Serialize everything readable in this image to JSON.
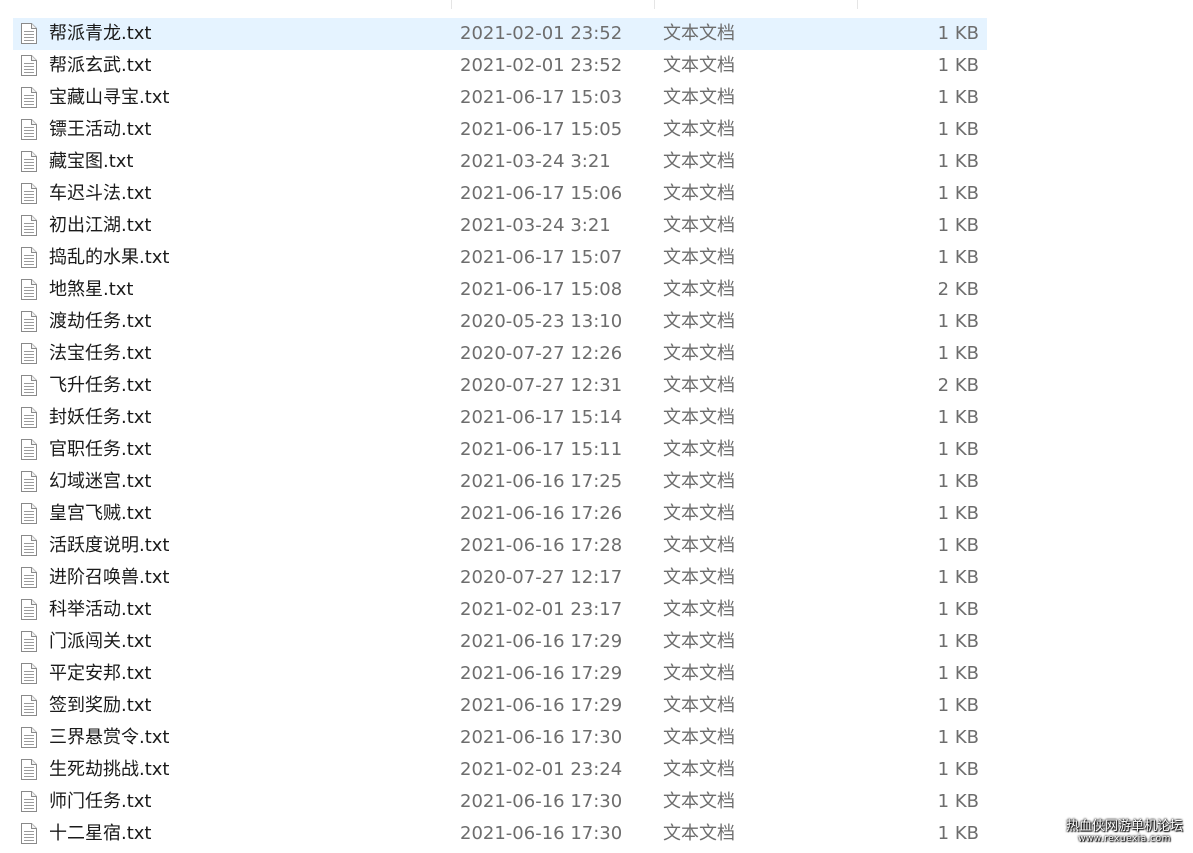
{
  "files": [
    {
      "name": "帮派青龙.txt",
      "date": "2021-02-01 23:52",
      "type": "文本文档",
      "size": "1 KB"
    },
    {
      "name": "帮派玄武.txt",
      "date": "2021-02-01 23:52",
      "type": "文本文档",
      "size": "1 KB"
    },
    {
      "name": "宝藏山寻宝.txt",
      "date": "2021-06-17 15:03",
      "type": "文本文档",
      "size": "1 KB"
    },
    {
      "name": "镖王活动.txt",
      "date": "2021-06-17 15:05",
      "type": "文本文档",
      "size": "1 KB"
    },
    {
      "name": "藏宝图.txt",
      "date": "2021-03-24 3:21",
      "type": "文本文档",
      "size": "1 KB"
    },
    {
      "name": "车迟斗法.txt",
      "date": "2021-06-17 15:06",
      "type": "文本文档",
      "size": "1 KB"
    },
    {
      "name": "初出江湖.txt",
      "date": "2021-03-24 3:21",
      "type": "文本文档",
      "size": "1 KB"
    },
    {
      "name": "捣乱的水果.txt",
      "date": "2021-06-17 15:07",
      "type": "文本文档",
      "size": "1 KB"
    },
    {
      "name": "地煞星.txt",
      "date": "2021-06-17 15:08",
      "type": "文本文档",
      "size": "2 KB"
    },
    {
      "name": "渡劫任务.txt",
      "date": "2020-05-23 13:10",
      "type": "文本文档",
      "size": "1 KB"
    },
    {
      "name": "法宝任务.txt",
      "date": "2020-07-27 12:26",
      "type": "文本文档",
      "size": "1 KB"
    },
    {
      "name": "飞升任务.txt",
      "date": "2020-07-27 12:31",
      "type": "文本文档",
      "size": "2 KB"
    },
    {
      "name": "封妖任务.txt",
      "date": "2021-06-17 15:14",
      "type": "文本文档",
      "size": "1 KB"
    },
    {
      "name": "官职任务.txt",
      "date": "2021-06-17 15:11",
      "type": "文本文档",
      "size": "1 KB"
    },
    {
      "name": "幻域迷宫.txt",
      "date": "2021-06-16 17:25",
      "type": "文本文档",
      "size": "1 KB"
    },
    {
      "name": "皇宫飞贼.txt",
      "date": "2021-06-16 17:26",
      "type": "文本文档",
      "size": "1 KB"
    },
    {
      "name": "活跃度说明.txt",
      "date": "2021-06-16 17:28",
      "type": "文本文档",
      "size": "1 KB"
    },
    {
      "name": "进阶召唤兽.txt",
      "date": "2020-07-27 12:17",
      "type": "文本文档",
      "size": "1 KB"
    },
    {
      "name": "科举活动.txt",
      "date": "2021-02-01 23:17",
      "type": "文本文档",
      "size": "1 KB"
    },
    {
      "name": "门派闯关.txt",
      "date": "2021-06-16 17:29",
      "type": "文本文档",
      "size": "1 KB"
    },
    {
      "name": "平定安邦.txt",
      "date": "2021-06-16 17:29",
      "type": "文本文档",
      "size": "1 KB"
    },
    {
      "name": "签到奖励.txt",
      "date": "2021-06-16 17:29",
      "type": "文本文档",
      "size": "1 KB"
    },
    {
      "name": "三界悬赏令.txt",
      "date": "2021-06-16 17:30",
      "type": "文本文档",
      "size": "1 KB"
    },
    {
      "name": "生死劫挑战.txt",
      "date": "2021-02-01 23:24",
      "type": "文本文档",
      "size": "1 KB"
    },
    {
      "name": "师门任务.txt",
      "date": "2021-06-16 17:30",
      "type": "文本文档",
      "size": "1 KB"
    },
    {
      "name": "十二星宿.txt",
      "date": "2021-06-16 17:30",
      "type": "文本文档",
      "size": "1 KB"
    }
  ],
  "selected_index": 0,
  "icons": {
    "file": "text-file-icon"
  },
  "colors": {
    "selection": "#e5f3ff",
    "name_text": "#1a1a1a",
    "meta_text": "#6d6d6d"
  },
  "watermark": {
    "title": "热血侠网游单机论坛",
    "url": "www.rexuexia.com"
  }
}
